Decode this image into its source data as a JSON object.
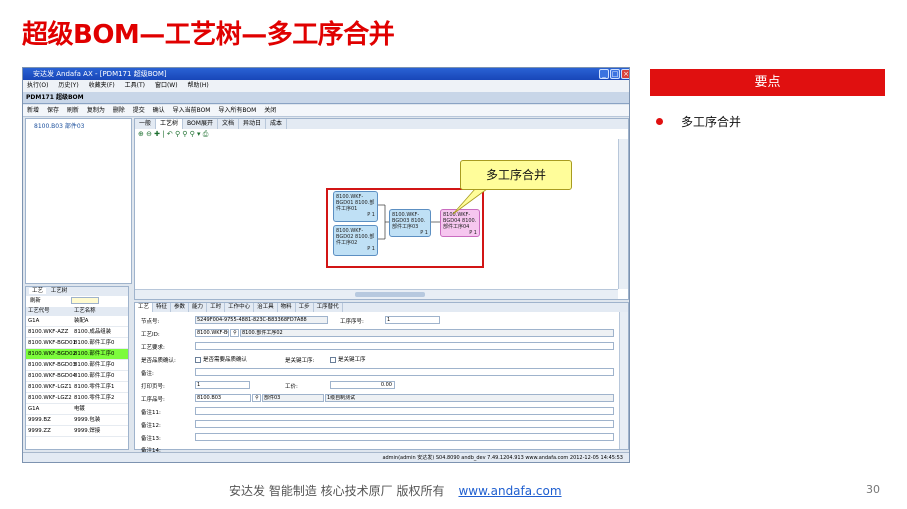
{
  "slide": {
    "title": "超级BOM—工艺树—多工序合并",
    "key_header": "要点",
    "bullet": "多工序合并",
    "footer_text": "安达发   智能制造  核心技术原厂    版权所有",
    "footer_url": "www.andafa.com",
    "page_number": "30"
  },
  "app": {
    "window_title": "安达发 Andafa AX - [PDM171 超级BOM]",
    "menu": [
      "执行(O)",
      "历史(Y)",
      "收藏夹(F)",
      "工具(T)",
      "窗口(W)",
      "帮助(H)"
    ],
    "doc_tab": "PDM171 超级BOM",
    "toolbar": [
      "新增",
      "保存",
      "刷新",
      "复制为",
      "删除",
      "提交",
      "确认",
      "导入当前BOM",
      "导入所有BOM",
      "关闭"
    ],
    "tree_root": "8100.B03 部件03",
    "subtabs": [
      "一般",
      "工艺树",
      "BOM展开",
      "文档",
      "异动日",
      "成本"
    ],
    "callout": "多工序合并",
    "nodes": [
      {
        "text": "8100.WKF-BGD01 8100.部件工序01",
        "tag": "P 1"
      },
      {
        "text": "8100.WKF-BGD02 8100.部件工序02",
        "tag": "P 1"
      },
      {
        "text": "8100.WKF-BGD03 8100.部件工序03",
        "tag": "P 1"
      },
      {
        "text": "8100.WKF-BGD04 8100.部件工序04",
        "tag": "P 1"
      }
    ],
    "left_tabs": [
      "工艺",
      "工艺树"
    ],
    "left_refresh": "刷新",
    "process_table": {
      "columns": [
        "工艺代号",
        "工艺名称"
      ],
      "rows": [
        [
          "G1A",
          "装配A"
        ],
        [
          "8100.WKF-AZZ",
          "8100.成品组装"
        ],
        [
          "8100.WKF-BGD01",
          "8100.部件工序0"
        ],
        [
          "8100.WKF-BGD02",
          "8100.部件工序0"
        ],
        [
          "8100.WKF-BGD03",
          "8100.部件工序0"
        ],
        [
          "8100.WKF-BGD04",
          "8100.部件工序0"
        ],
        [
          "8100.WKF-LGZ1",
          "8100.零件工序1"
        ],
        [
          "8100.WKF-LGZ2",
          "8100.零件工序2"
        ],
        [
          "G1A",
          "电镀"
        ],
        [
          "9999.BZ",
          "9999.包装"
        ],
        [
          "9999.ZZ",
          "9999.焊接"
        ]
      ],
      "selected_index": 3
    },
    "form_tabs": [
      "工艺",
      "特征",
      "参数",
      "能力",
      "工时",
      "工作中心",
      "治工具",
      "物料",
      "工步",
      "工序替代"
    ],
    "form": {
      "node_no_label": "节点号:",
      "node_no": "5249F004-9755-4881-823C-B83368FD7A88",
      "seq_label": "工序序号:",
      "seq": "1",
      "process_id_label": "工艺ID:",
      "process_id": "8100.WKF-BC",
      "process_name": "8100.部件工序02",
      "requirement_label": "工艺要求:",
      "quality_label": "是否品质确认:",
      "quality_check": "是否需要品质确认",
      "key_label": "是关键工序:",
      "key_check": "是关键工序",
      "remark_label": "备注:",
      "print_page_label": "打印页号:",
      "print_page": "1",
      "hours_label": "工价:",
      "hours": "0.00",
      "part_label": "工序品号:",
      "part_code": "8100.B03",
      "part_name": "部件03",
      "part_desc": "1级自制测试",
      "remark11": "备注11:",
      "remark12": "备注12:",
      "remark13": "备注13:",
      "remark14": "备注14:"
    },
    "status": "admin(admin 安达发)  S04.8090  andb_dev  7.49.1204.913  www.andafa.com  2012-12-05 14:45:53"
  }
}
